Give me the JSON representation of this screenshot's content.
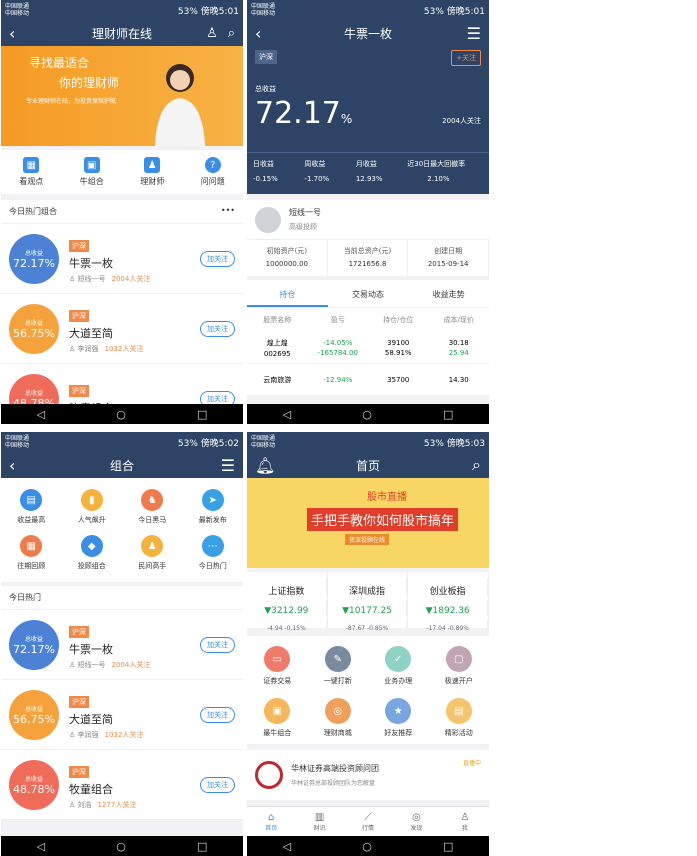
{
  "status": {
    "carrier": "中国联通",
    "carrier2": "中国移动",
    "s1": {
      "battery": "53%",
      "time": "傍晚5:01"
    },
    "s2": {
      "battery": "53%",
      "time": "傍晚5:01"
    },
    "s3": {
      "battery": "53%",
      "time": "傍晚5:02"
    },
    "s4": {
      "battery": "53%",
      "time": "傍晚5:03"
    }
  },
  "s1": {
    "title": "理财师在线",
    "banner": {
      "line1": "寻找最适合",
      "line2": "你的理财师",
      "line3": "专业理财师在线，为投资保驾护航"
    },
    "quick": [
      "看观点",
      "牛组合",
      "理财师",
      "问问题"
    ],
    "section": "今日热门组合",
    "more": "•••",
    "combos": [
      {
        "tag": "沪深",
        "name": "牛票一枚",
        "label": "总收益",
        "value": "72.17%",
        "user": "短线一号",
        "followers": "2004人关注",
        "btn": "加关注"
      },
      {
        "tag": "沪深",
        "name": "大道至简",
        "label": "总收益",
        "value": "56.75%",
        "user": "李润强",
        "followers": "1032人关注",
        "btn": "加关注"
      },
      {
        "tag": "沪深",
        "name": "牧童组合",
        "label": "总收益",
        "value": "48.78%",
        "user": "",
        "followers": "",
        "btn": "加关注"
      }
    ]
  },
  "s2": {
    "title": "牛票一枚",
    "tag": "沪深",
    "follow": "+关注",
    "total_label": "总收益",
    "total_value": "72.17",
    "total_unit": "%",
    "followers": "2004人关注",
    "stats": [
      {
        "label": "日收益",
        "value": "-0.15%"
      },
      {
        "label": "周收益",
        "value": "-1.70%"
      },
      {
        "label": "月收益",
        "value": "12.93%"
      },
      {
        "label": "近30日最大回撤率",
        "value": "2.10%"
      }
    ],
    "manager": {
      "name": "短线一号",
      "level": "高级投顾"
    },
    "assets": [
      {
        "label": "初始资产(元)",
        "value": "1000000.00"
      },
      {
        "label": "当前总资产(元)",
        "value": "1721656.8"
      },
      {
        "label": "创建日期",
        "value": "2015-09-14"
      }
    ],
    "tabs": [
      "持仓",
      "交易动态",
      "收益走势"
    ],
    "thead": [
      "股票名称",
      "盈亏",
      "持仓/仓位",
      "成本/现价"
    ],
    "rows": [
      {
        "name": "煌上煌",
        "code": "002695",
        "pct": "-14.05%",
        "amt": "-165784.00",
        "hold": "39100",
        "pos": "58.91%",
        "cost": "30.18",
        "price": "25.94"
      },
      {
        "name": "云南旅游",
        "code": "",
        "pct": "-12.94%",
        "amt": "",
        "hold": "35700",
        "pos": "",
        "cost": "14.30",
        "price": ""
      }
    ]
  },
  "s3": {
    "title": "组合",
    "grid": [
      "收益最高",
      "人气飙升",
      "今日黑马",
      "最新发布",
      "往期回顾",
      "投顾组合",
      "民间高手",
      "今日热门"
    ],
    "section": "今日热门",
    "combos": [
      {
        "tag": "沪深",
        "name": "牛票一枚",
        "label": "总收益",
        "value": "72.17%",
        "user": "短线一号",
        "followers": "2004人关注",
        "btn": "加关注"
      },
      {
        "tag": "沪深",
        "name": "大道至简",
        "label": "总收益",
        "value": "56.75%",
        "user": "李润强",
        "followers": "1032人关注",
        "btn": "加关注"
      },
      {
        "tag": "沪深",
        "name": "牧童组合",
        "label": "总收益",
        "value": "48.78%",
        "user": "刘浩",
        "followers": "1277人关注",
        "btn": "加关注"
      }
    ]
  },
  "s4": {
    "title": "首页",
    "ad": {
      "l1": "股市直播",
      "l2": "手把手教你如何股市搞年",
      "l3": "资深投顾在线"
    },
    "indices": [
      {
        "name": "上证指数",
        "value": "▼3212.99",
        "change": "-4.94  -0.15%"
      },
      {
        "name": "深圳成指",
        "value": "▼10177.25",
        "change": "-87.67  -0.85%"
      },
      {
        "name": "创业板指",
        "value": "▼1892.36",
        "change": "-17.04  -0.89%"
      }
    ],
    "grid": [
      "证券交易",
      "一键打新",
      "业务办理",
      "极速开户",
      "最牛组合",
      "理财商城",
      "好友推荐",
      "精彩活动"
    ],
    "news": {
      "title": "华林证券高端投资顾问团",
      "sub": "华林证券总部投顾团队为您解盘",
      "live": "直播中"
    },
    "tabbar": [
      "首页",
      "财讯",
      "行情",
      "发现",
      "我"
    ]
  },
  "colors": {
    "header": "#2e4466",
    "blue": "#3a8ee6",
    "orange": "#f08a4b",
    "green": "#1ca34e"
  }
}
